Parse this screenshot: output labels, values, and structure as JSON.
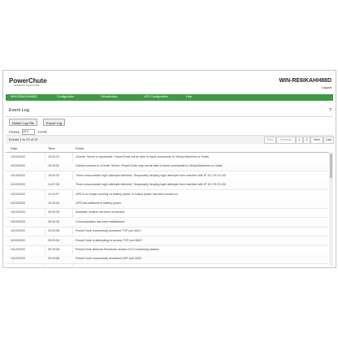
{
  "header": {
    "brand": "PowerChute",
    "brand_sub": "NETWORK SHUTDOWN",
    "host": "WIN-RE6IKAHH88D",
    "logout": "Logout"
  },
  "nav": [
    "WIN-RE6IKAHH88D",
    "Configuration",
    "Virtualization",
    "UPS Configuration",
    "Help"
  ],
  "section": {
    "title": "Event Log",
    "help": "?"
  },
  "buttons": {
    "delete": "Delete Log File",
    "export": "Export Log"
  },
  "display": {
    "prefix": "Display",
    "value": "20",
    "suffix": "events"
  },
  "info": "Events 1 to 20 of 22",
  "pagination": [
    "First",
    "Previous",
    "1",
    "2",
    "Next",
    "Last"
  ],
  "columns": [
    "Date",
    "Time",
    "Event"
  ],
  "rows": [
    {
      "date": "10/19/2022",
      "time": "15:32:31",
      "event": "vCenter Server is accessible. PowerChute will be able to issue commands to Virtual Machines or Hosts."
    },
    {
      "date": "10/19/2022",
      "time": "15:25:52",
      "event": "Cannot connect to vCenter Server. PowerChute may not be able to issue commands to Virtual Machines or Hosts."
    },
    {
      "date": "10/19/2022",
      "time": "15:02:03",
      "event": "Three unsuccessful login attempts detected. Temporarily denying login attempts from machine with IP 10.179.211.52."
    },
    {
      "date": "10/19/2022",
      "time": "14:57:26",
      "event": "Three unsuccessful login attempts detected. Temporarily denying login attempts from machine with IP 10.179.211.52."
    },
    {
      "date": "10/19/2022",
      "time": "14:10:07",
      "event": "UPS is no longer running on battery power or output power has been turned on."
    },
    {
      "date": "10/19/2022",
      "time": "14:10:03",
      "event": "UPS has switched to battery power."
    },
    {
      "date": "10/19/2022",
      "time": "09:20:28",
      "event": "Available runtime has been exceeded."
    },
    {
      "date": "10/19/2022",
      "time": "09:20:28",
      "event": "Communication has been established."
    },
    {
      "date": "10/19/2022",
      "time": "09:20:06",
      "event": "PowerChute successfully accessed TCP port 6547."
    },
    {
      "date": "10/19/2022",
      "time": "09:20:06",
      "event": "PowerChute is attempting to access TCP port 6547."
    },
    {
      "date": "10/19/2022",
      "time": "09:19:58",
      "event": "PowerChute Network Shutdown version 5.0.0 monitoring started."
    },
    {
      "date": "10/19/2022",
      "time": "09:19:58",
      "event": "PowerChute successfully accessed UDP port 3052."
    }
  ]
}
